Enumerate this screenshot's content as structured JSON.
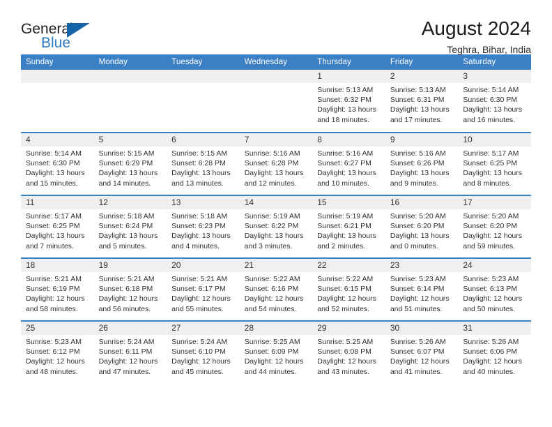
{
  "brand": {
    "name_part1": "General",
    "name_part2": "Blue",
    "logo_icon": "triangle-logo-icon"
  },
  "header": {
    "title": "August 2024",
    "location": "Teghra, Bihar, India"
  },
  "theme": {
    "accent_blue": "#3b7fc4",
    "brand_blue": "#2b7cc0",
    "daynum_bg": "#efefef",
    "text": "#303030"
  },
  "calendar": {
    "weekday_headers": [
      "Sunday",
      "Monday",
      "Tuesday",
      "Wednesday",
      "Thursday",
      "Friday",
      "Saturday"
    ],
    "weeks": [
      [
        {
          "day": "",
          "blank": true
        },
        {
          "day": "",
          "blank": true
        },
        {
          "day": "",
          "blank": true
        },
        {
          "day": "",
          "blank": true
        },
        {
          "day": "1",
          "sunrise": "Sunrise: 5:13 AM",
          "sunset": "Sunset: 6:32 PM",
          "daylight1": "Daylight: 13 hours",
          "daylight2": "and 18 minutes."
        },
        {
          "day": "2",
          "sunrise": "Sunrise: 5:13 AM",
          "sunset": "Sunset: 6:31 PM",
          "daylight1": "Daylight: 13 hours",
          "daylight2": "and 17 minutes."
        },
        {
          "day": "3",
          "sunrise": "Sunrise: 5:14 AM",
          "sunset": "Sunset: 6:30 PM",
          "daylight1": "Daylight: 13 hours",
          "daylight2": "and 16 minutes."
        }
      ],
      [
        {
          "day": "4",
          "sunrise": "Sunrise: 5:14 AM",
          "sunset": "Sunset: 6:30 PM",
          "daylight1": "Daylight: 13 hours",
          "daylight2": "and 15 minutes."
        },
        {
          "day": "5",
          "sunrise": "Sunrise: 5:15 AM",
          "sunset": "Sunset: 6:29 PM",
          "daylight1": "Daylight: 13 hours",
          "daylight2": "and 14 minutes."
        },
        {
          "day": "6",
          "sunrise": "Sunrise: 5:15 AM",
          "sunset": "Sunset: 6:28 PM",
          "daylight1": "Daylight: 13 hours",
          "daylight2": "and 13 minutes."
        },
        {
          "day": "7",
          "sunrise": "Sunrise: 5:16 AM",
          "sunset": "Sunset: 6:28 PM",
          "daylight1": "Daylight: 13 hours",
          "daylight2": "and 12 minutes."
        },
        {
          "day": "8",
          "sunrise": "Sunrise: 5:16 AM",
          "sunset": "Sunset: 6:27 PM",
          "daylight1": "Daylight: 13 hours",
          "daylight2": "and 10 minutes."
        },
        {
          "day": "9",
          "sunrise": "Sunrise: 5:16 AM",
          "sunset": "Sunset: 6:26 PM",
          "daylight1": "Daylight: 13 hours",
          "daylight2": "and 9 minutes."
        },
        {
          "day": "10",
          "sunrise": "Sunrise: 5:17 AM",
          "sunset": "Sunset: 6:25 PM",
          "daylight1": "Daylight: 13 hours",
          "daylight2": "and 8 minutes."
        }
      ],
      [
        {
          "day": "11",
          "sunrise": "Sunrise: 5:17 AM",
          "sunset": "Sunset: 6:25 PM",
          "daylight1": "Daylight: 13 hours",
          "daylight2": "and 7 minutes."
        },
        {
          "day": "12",
          "sunrise": "Sunrise: 5:18 AM",
          "sunset": "Sunset: 6:24 PM",
          "daylight1": "Daylight: 13 hours",
          "daylight2": "and 5 minutes."
        },
        {
          "day": "13",
          "sunrise": "Sunrise: 5:18 AM",
          "sunset": "Sunset: 6:23 PM",
          "daylight1": "Daylight: 13 hours",
          "daylight2": "and 4 minutes."
        },
        {
          "day": "14",
          "sunrise": "Sunrise: 5:19 AM",
          "sunset": "Sunset: 6:22 PM",
          "daylight1": "Daylight: 13 hours",
          "daylight2": "and 3 minutes."
        },
        {
          "day": "15",
          "sunrise": "Sunrise: 5:19 AM",
          "sunset": "Sunset: 6:21 PM",
          "daylight1": "Daylight: 13 hours",
          "daylight2": "and 2 minutes."
        },
        {
          "day": "16",
          "sunrise": "Sunrise: 5:20 AM",
          "sunset": "Sunset: 6:20 PM",
          "daylight1": "Daylight: 13 hours",
          "daylight2": "and 0 minutes."
        },
        {
          "day": "17",
          "sunrise": "Sunrise: 5:20 AM",
          "sunset": "Sunset: 6:20 PM",
          "daylight1": "Daylight: 12 hours",
          "daylight2": "and 59 minutes."
        }
      ],
      [
        {
          "day": "18",
          "sunrise": "Sunrise: 5:21 AM",
          "sunset": "Sunset: 6:19 PM",
          "daylight1": "Daylight: 12 hours",
          "daylight2": "and 58 minutes."
        },
        {
          "day": "19",
          "sunrise": "Sunrise: 5:21 AM",
          "sunset": "Sunset: 6:18 PM",
          "daylight1": "Daylight: 12 hours",
          "daylight2": "and 56 minutes."
        },
        {
          "day": "20",
          "sunrise": "Sunrise: 5:21 AM",
          "sunset": "Sunset: 6:17 PM",
          "daylight1": "Daylight: 12 hours",
          "daylight2": "and 55 minutes."
        },
        {
          "day": "21",
          "sunrise": "Sunrise: 5:22 AM",
          "sunset": "Sunset: 6:16 PM",
          "daylight1": "Daylight: 12 hours",
          "daylight2": "and 54 minutes."
        },
        {
          "day": "22",
          "sunrise": "Sunrise: 5:22 AM",
          "sunset": "Sunset: 6:15 PM",
          "daylight1": "Daylight: 12 hours",
          "daylight2": "and 52 minutes."
        },
        {
          "day": "23",
          "sunrise": "Sunrise: 5:23 AM",
          "sunset": "Sunset: 6:14 PM",
          "daylight1": "Daylight: 12 hours",
          "daylight2": "and 51 minutes."
        },
        {
          "day": "24",
          "sunrise": "Sunrise: 5:23 AM",
          "sunset": "Sunset: 6:13 PM",
          "daylight1": "Daylight: 12 hours",
          "daylight2": "and 50 minutes."
        }
      ],
      [
        {
          "day": "25",
          "sunrise": "Sunrise: 5:23 AM",
          "sunset": "Sunset: 6:12 PM",
          "daylight1": "Daylight: 12 hours",
          "daylight2": "and 48 minutes."
        },
        {
          "day": "26",
          "sunrise": "Sunrise: 5:24 AM",
          "sunset": "Sunset: 6:11 PM",
          "daylight1": "Daylight: 12 hours",
          "daylight2": "and 47 minutes."
        },
        {
          "day": "27",
          "sunrise": "Sunrise: 5:24 AM",
          "sunset": "Sunset: 6:10 PM",
          "daylight1": "Daylight: 12 hours",
          "daylight2": "and 45 minutes."
        },
        {
          "day": "28",
          "sunrise": "Sunrise: 5:25 AM",
          "sunset": "Sunset: 6:09 PM",
          "daylight1": "Daylight: 12 hours",
          "daylight2": "and 44 minutes."
        },
        {
          "day": "29",
          "sunrise": "Sunrise: 5:25 AM",
          "sunset": "Sunset: 6:08 PM",
          "daylight1": "Daylight: 12 hours",
          "daylight2": "and 43 minutes."
        },
        {
          "day": "30",
          "sunrise": "Sunrise: 5:26 AM",
          "sunset": "Sunset: 6:07 PM",
          "daylight1": "Daylight: 12 hours",
          "daylight2": "and 41 minutes."
        },
        {
          "day": "31",
          "sunrise": "Sunrise: 5:26 AM",
          "sunset": "Sunset: 6:06 PM",
          "daylight1": "Daylight: 12 hours",
          "daylight2": "and 40 minutes."
        }
      ]
    ]
  }
}
